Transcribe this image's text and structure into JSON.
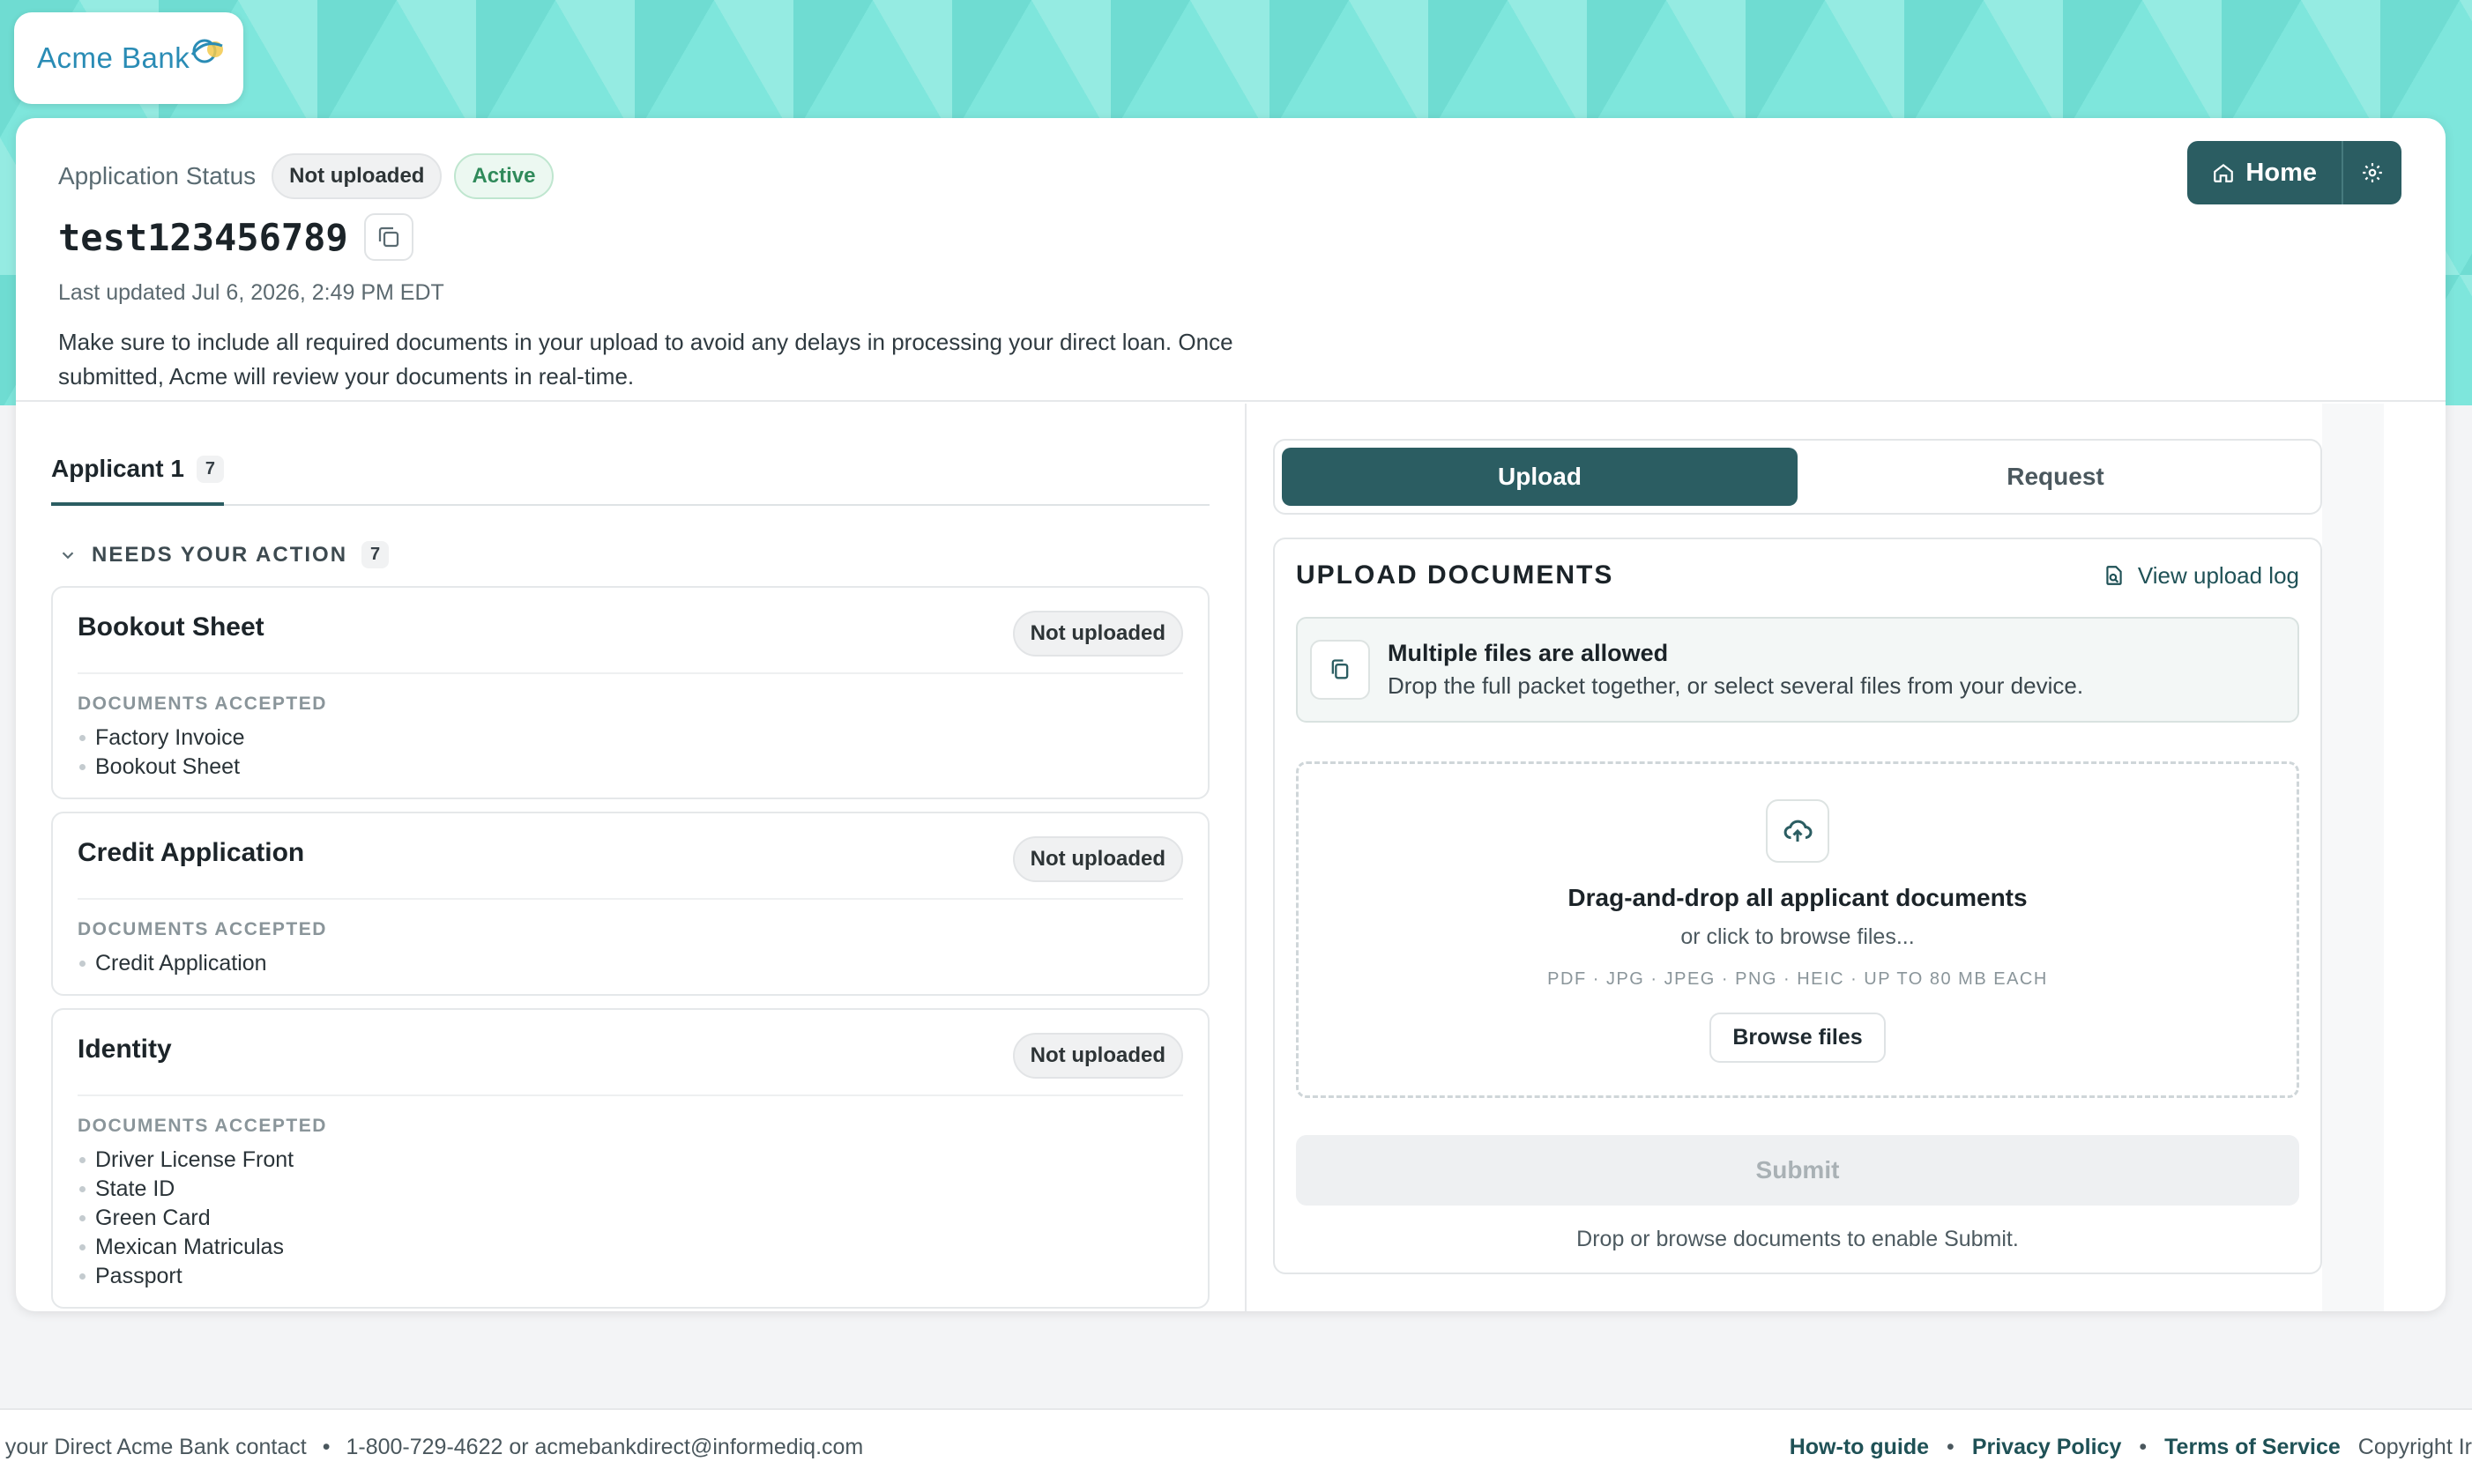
{
  "brand": {
    "name": "Acme Bank",
    "colors": {
      "primary": "#2b5d62",
      "banner": "#7ee6dc",
      "logo": "#2a8cb5"
    }
  },
  "header": {
    "status_label": "Application Status",
    "status_pill": "Not uploaded",
    "active_pill": "Active",
    "app_id": "test123456789",
    "last_updated": "Last updated Jul 6, 2026, 2:49 PM EDT",
    "intro": "Make sure to include all required documents in your upload to avoid any delays in processing your direct loan. Once submitted, Acme will review your documents in real-time.",
    "home_label": "Home",
    "icons": {
      "copy": "copy-icon",
      "home": "home-icon",
      "settings": "gear-icon"
    }
  },
  "left": {
    "tab": {
      "label": "Applicant 1",
      "count": "7"
    },
    "section": {
      "title": "NEEDS YOUR ACTION",
      "count": "7"
    },
    "accepted_label": "DOCUMENTS ACCEPTED",
    "cards": [
      {
        "title": "Bookout Sheet",
        "status": "Not uploaded",
        "docs": [
          "Factory Invoice",
          "Bookout Sheet"
        ]
      },
      {
        "title": "Credit Application",
        "status": "Not uploaded",
        "docs": [
          "Credit Application"
        ]
      },
      {
        "title": "Identity",
        "status": "Not uploaded",
        "docs": [
          "Driver License Front",
          "State ID",
          "Green Card",
          "Mexican Matriculas",
          "Passport"
        ]
      }
    ]
  },
  "right": {
    "segments": {
      "upload": "Upload",
      "request": "Request"
    },
    "panel_title": "UPLOAD DOCUMENTS",
    "log_link": "View upload log",
    "info": {
      "title": "Multiple files are allowed",
      "sub": "Drop the full packet together, or select several files from your device."
    },
    "dropzone": {
      "title": "Drag-and-drop all applicant documents",
      "sub": "or click to browse files...",
      "types": "PDF · JPG · JPEG · PNG · HEIC · UP TO 80 MB EACH",
      "browse": "Browse files"
    },
    "submit": "Submit",
    "submit_hint": "Drop or browse documents to enable Submit."
  },
  "footer": {
    "contact": "t your Direct Acme Bank contact",
    "phone_email": "1-800-729-4622 or acmebankdirect@informediq.com",
    "links": [
      "How-to guide",
      "Privacy Policy",
      "Terms of Service"
    ],
    "copyright": "Copyright Ir"
  }
}
